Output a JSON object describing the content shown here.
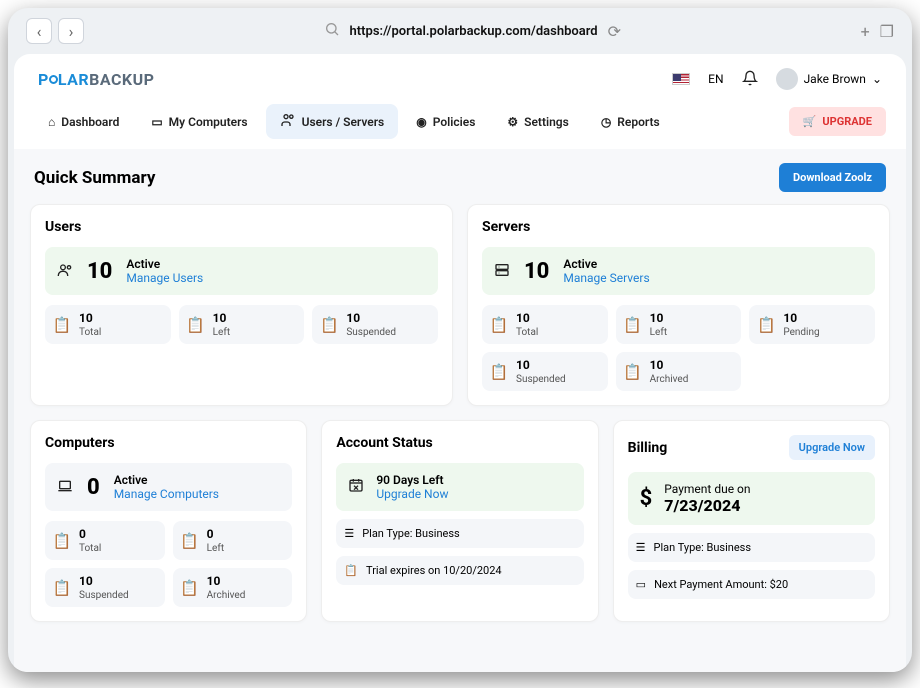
{
  "browser": {
    "url": "https://portal.polarbackup.com/dashboard"
  },
  "logo": {
    "part1": "P",
    "part2": "LAR",
    "part3": "BACKUP"
  },
  "header": {
    "lang": "EN",
    "user": "Jake Brown"
  },
  "nav": {
    "dashboard": "Dashboard",
    "computers": "My Computers",
    "users": "Users / Servers",
    "policies": "Policies",
    "settings": "Settings",
    "reports": "Reports",
    "upgrade": "UPGRADE"
  },
  "summary": {
    "title": "Quick Summary",
    "download": "Download Zoolz"
  },
  "users_card": {
    "title": "Users",
    "count": "10",
    "active": "Active",
    "manage": "Manage Users",
    "total_n": "10",
    "total_l": "Total",
    "left_n": "10",
    "left_l": "Left",
    "susp_n": "10",
    "susp_l": "Suspended"
  },
  "servers_card": {
    "title": "Servers",
    "count": "10",
    "active": "Active",
    "manage": "Manage Servers",
    "total_n": "10",
    "total_l": "Total",
    "left_n": "10",
    "left_l": "Left",
    "pend_n": "10",
    "pend_l": "Pending",
    "susp_n": "10",
    "susp_l": "Suspended",
    "arch_n": "10",
    "arch_l": "Archived"
  },
  "computers_card": {
    "title": "Computers",
    "count": "0",
    "active": "Active",
    "manage": "Manage Computers",
    "total_n": "0",
    "total_l": "Total",
    "left_n": "0",
    "left_l": "Left",
    "susp_n": "10",
    "susp_l": "Suspended",
    "arch_n": "10",
    "arch_l": "Archived"
  },
  "account_card": {
    "title": "Account Status",
    "days": "90 Days Left",
    "upgrade": "Upgrade Now",
    "plan": "Plan Type: Business",
    "trial": "Trial expires on 10/20/2024"
  },
  "billing_card": {
    "title": "Billing",
    "upgrade": "Upgrade Now",
    "due_label": "Payment due on",
    "due_date": "7/23/2024",
    "plan": "Plan Type: Business",
    "next": "Next Payment Amount: $20"
  }
}
